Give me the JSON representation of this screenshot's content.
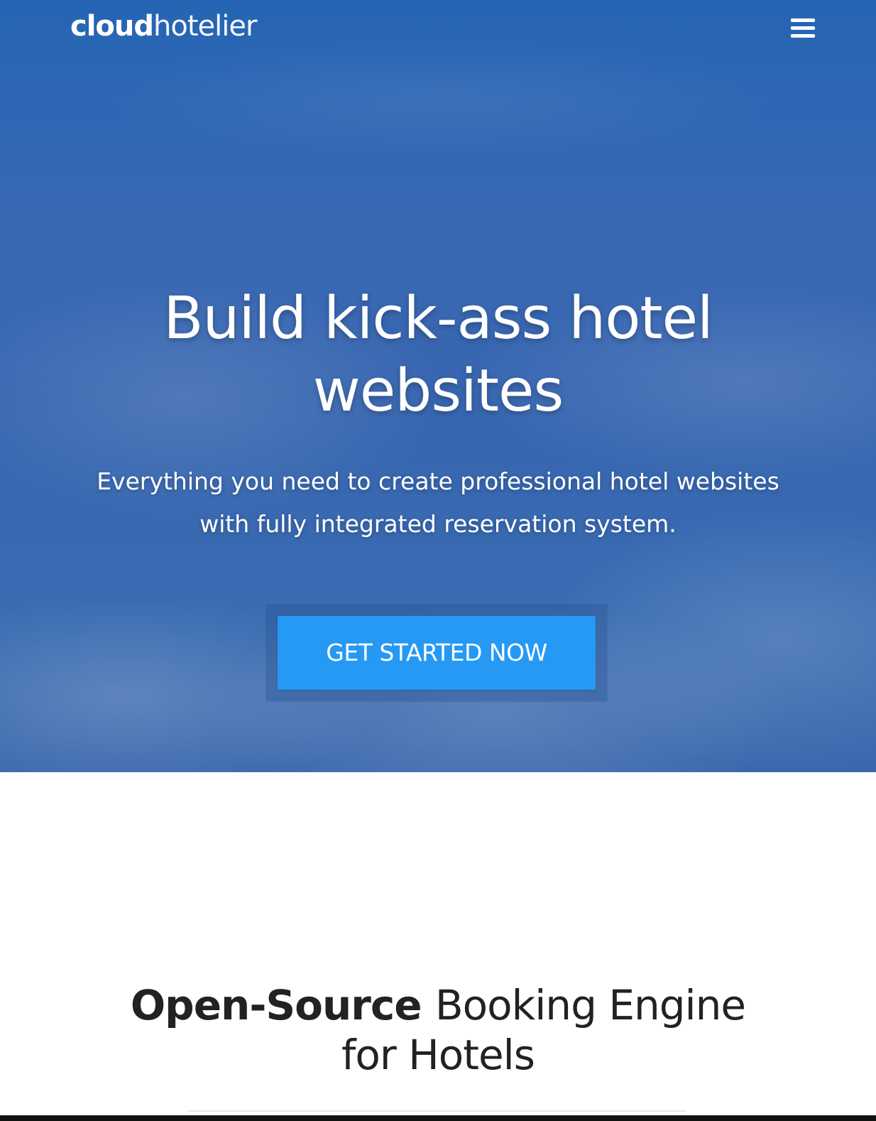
{
  "header": {
    "logo": {
      "part_bold": "cloud",
      "part_light": "hotelier"
    },
    "menu_icon": "hamburger-menu-icon"
  },
  "hero": {
    "title": "Build kick-ass hotel websites",
    "subtitle": "Everything you need to create professional hotel websites with fully integrated reservation system.",
    "cta_label": "GET STARTED NOW",
    "background_color": "#2f68b3",
    "cta_color": "#2599f3"
  },
  "section": {
    "title_strong": "Open-Source",
    "title_rest": "Booking Engine for Hotels"
  }
}
